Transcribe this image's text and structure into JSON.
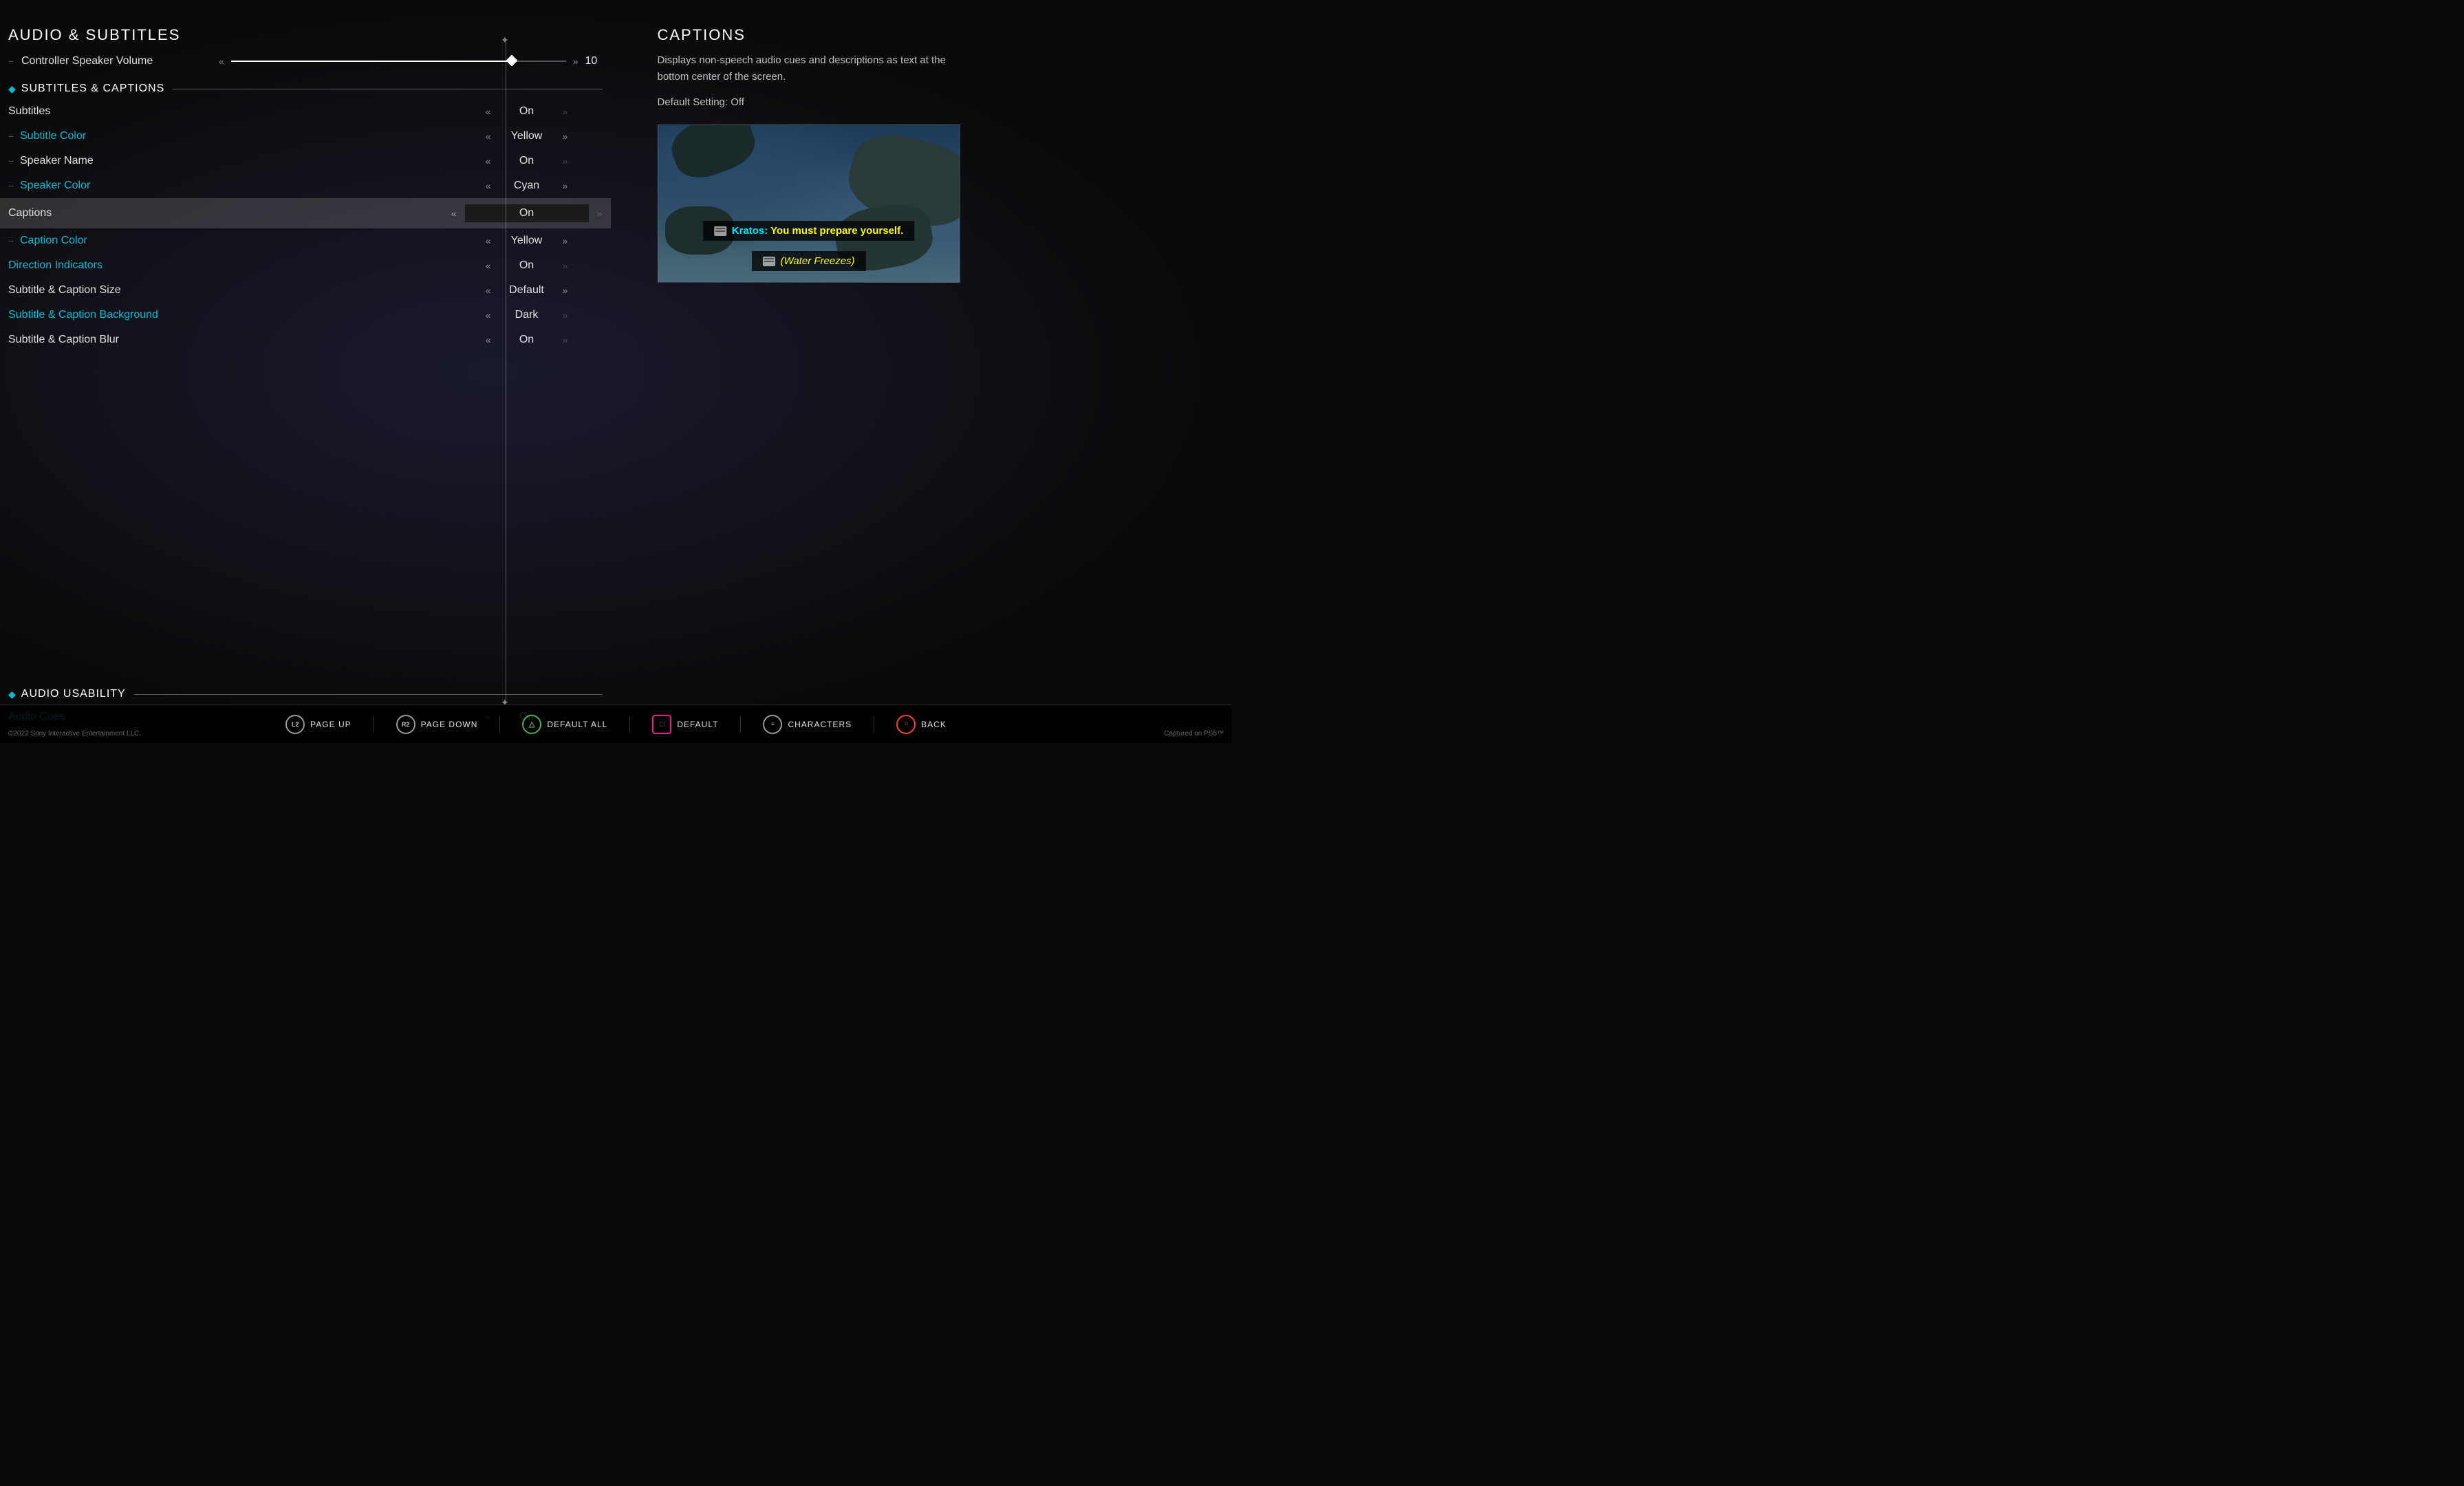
{
  "leftPanel": {
    "mainTitle": "AUDIO & SUBTITLES",
    "controllerRow": {
      "icon": "···",
      "label": "Controller Speaker Volume",
      "value": "10"
    },
    "subtitlesCaptionsSection": {
      "title": "SUBTITLES & CAPTIONS",
      "rows": [
        {
          "id": "subtitles",
          "label": "Subtitles",
          "value": "On",
          "cyan": false,
          "hasIcon": false,
          "active": false
        },
        {
          "id": "subtitle-color",
          "label": "Subtitle Color",
          "value": "Yellow",
          "cyan": true,
          "hasIcon": true,
          "active": false
        },
        {
          "id": "speaker-name",
          "label": "Speaker Name",
          "value": "On",
          "cyan": false,
          "hasIcon": false,
          "active": false
        },
        {
          "id": "speaker-color",
          "label": "Speaker Color",
          "value": "Cyan",
          "cyan": true,
          "hasIcon": true,
          "active": false
        },
        {
          "id": "captions",
          "label": "Captions",
          "value": "On",
          "cyan": false,
          "hasIcon": false,
          "active": true
        },
        {
          "id": "caption-color",
          "label": "Caption Color",
          "value": "Yellow",
          "cyan": true,
          "hasIcon": true,
          "active": false
        },
        {
          "id": "direction-indicators",
          "label": "Direction Indicators",
          "value": "On",
          "cyan": true,
          "hasIcon": false,
          "active": false
        },
        {
          "id": "subtitle-caption-size",
          "label": "Subtitle & Caption Size",
          "value": "Default",
          "cyan": false,
          "hasIcon": false,
          "active": false
        },
        {
          "id": "subtitle-caption-bg",
          "label": "Subtitle & Caption Background",
          "value": "Dark",
          "cyan": true,
          "hasIcon": false,
          "active": false
        },
        {
          "id": "subtitle-caption-blur",
          "label": "Subtitle & Caption Blur",
          "value": "On",
          "cyan": false,
          "hasIcon": false,
          "active": false
        }
      ]
    },
    "audioUsabilitySection": {
      "title": "AUDIO USABILITY",
      "rows": [
        {
          "id": "audio-cues",
          "label": "Audio Cues",
          "value": "On",
          "cyan": true,
          "hasIcon": false,
          "active": false
        }
      ]
    }
  },
  "rightPanel": {
    "title": "CAPTIONS",
    "description": "Displays non-speech audio cues and descriptions as text at the bottom center of the screen.",
    "defaultSetting": "Default Setting: Off",
    "preview": {
      "subtitleText": "Kratos: You must prepare yourself.",
      "captionText": "(Water Freezes)"
    }
  },
  "bottomBar": {
    "actions": [
      {
        "id": "page-up",
        "btnLabel": "L2",
        "label": "PAGE UP"
      },
      {
        "id": "page-down",
        "btnLabel": "R2",
        "label": "PAGE DOWN"
      },
      {
        "id": "default-all",
        "btnLabel": "△",
        "label": "DEFAULT ALL"
      },
      {
        "id": "default",
        "btnLabel": "□",
        "label": "DEFAULT"
      },
      {
        "id": "characters",
        "btnLabel": "≡",
        "label": "CHARACTERS"
      },
      {
        "id": "back",
        "btnLabel": "○",
        "label": "BACK"
      }
    ]
  },
  "footer": {
    "copyright": "©2022 Sony Interactive Entertainment LLC.",
    "captured": "Captured on PS5™"
  }
}
